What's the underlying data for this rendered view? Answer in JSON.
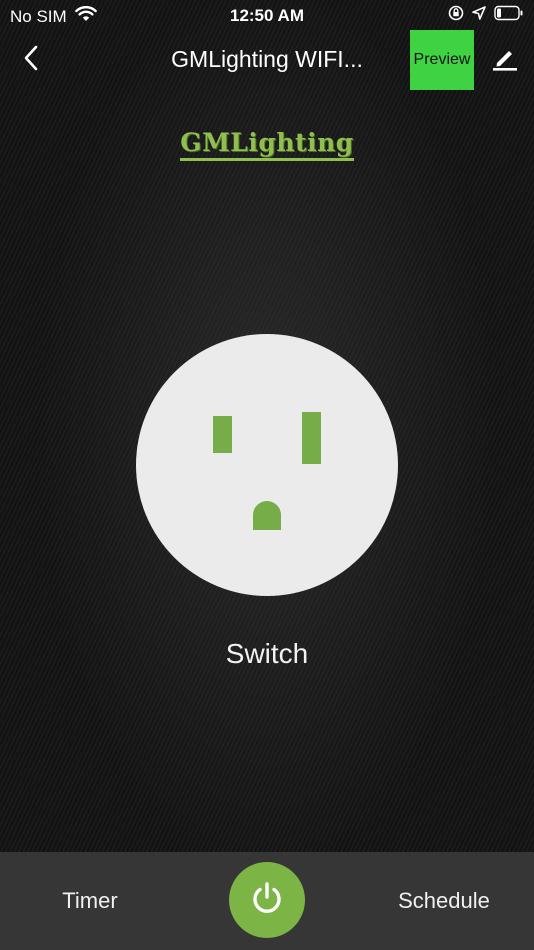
{
  "status_bar": {
    "carrier": "No SIM",
    "time": "12:50 AM",
    "icons": [
      "wifi-icon",
      "orientation-lock-icon",
      "location-icon",
      "battery-icon"
    ]
  },
  "nav": {
    "back_icon": "chevron-left-icon",
    "title": "GMLighting WIFI...",
    "preview_label": "Preview",
    "edit_icon": "pencil-icon"
  },
  "brand": {
    "logo_text": "GMLighting"
  },
  "device": {
    "label": "Switch",
    "icon": "outlet-icon"
  },
  "bottom_bar": {
    "timer_label": "Timer",
    "power_icon": "power-icon",
    "schedule_label": "Schedule"
  },
  "colors": {
    "accent_green": "#7cb446",
    "preview_green": "#3fd343",
    "background": "#141414",
    "bottom_bar": "#363636",
    "outlet_face": "#ebebeb"
  }
}
